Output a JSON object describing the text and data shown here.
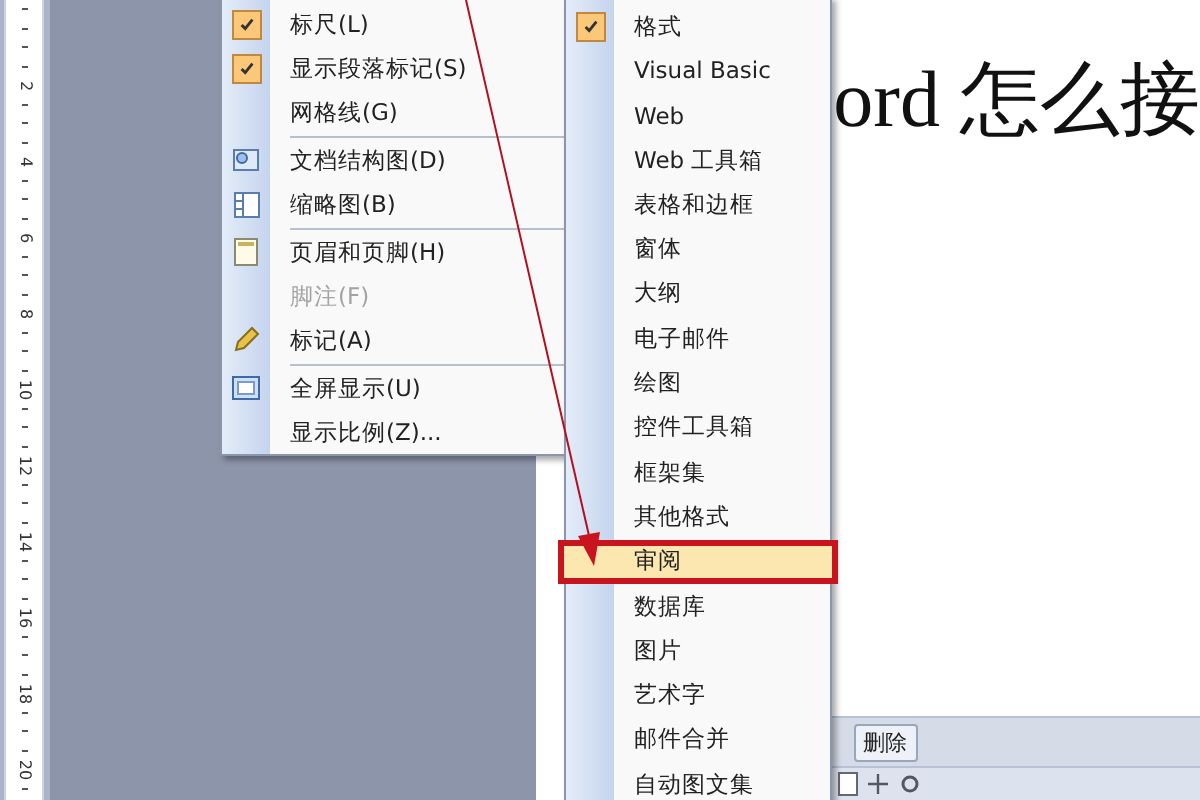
{
  "ruler": {
    "labels": [
      "2",
      "4",
      "6",
      "8",
      "10",
      "12",
      "14",
      "16",
      "18",
      "20"
    ]
  },
  "document": {
    "heading": "ord 怎么接"
  },
  "view_menu": {
    "groups": [
      [
        {
          "label": "标尺(L)",
          "kind": "toggle",
          "checked": true,
          "disabled": false
        },
        {
          "label": "显示段落标记(S)",
          "kind": "toggle",
          "checked": true,
          "disabled": false
        },
        {
          "label": "网格线(G)",
          "kind": "toggle",
          "checked": false,
          "disabled": false
        }
      ],
      [
        {
          "label": "文档结构图(D)",
          "kind": "docmap",
          "disabled": false
        },
        {
          "label": "缩略图(B)",
          "kind": "thumbnails",
          "disabled": false
        }
      ],
      [
        {
          "label": "页眉和页脚(H)",
          "kind": "header",
          "disabled": false
        },
        {
          "label": "脚注(F)",
          "kind": "plain",
          "disabled": true
        },
        {
          "label": "标记(A)",
          "kind": "marker",
          "disabled": false
        }
      ],
      [
        {
          "label": "全屏显示(U)",
          "kind": "fullscreen",
          "disabled": false
        },
        {
          "label": "显示比例(Z)...",
          "kind": "plain",
          "disabled": false
        }
      ]
    ]
  },
  "toolbars_menu": {
    "items": [
      {
        "label": "格式",
        "checked": true,
        "selected": false
      },
      {
        "label": "Visual Basic",
        "checked": false,
        "selected": false
      },
      {
        "label": "Web",
        "checked": false,
        "selected": false
      },
      {
        "label": "Web 工具箱",
        "checked": false,
        "selected": false
      },
      {
        "label": "表格和边框",
        "checked": false,
        "selected": false
      },
      {
        "label": "窗体",
        "checked": false,
        "selected": false
      },
      {
        "label": "大纲",
        "checked": false,
        "selected": false
      },
      {
        "label": "电子邮件",
        "checked": false,
        "selected": false
      },
      {
        "label": "绘图",
        "checked": false,
        "selected": false
      },
      {
        "label": "控件工具箱",
        "checked": false,
        "selected": false
      },
      {
        "label": "框架集",
        "checked": false,
        "selected": false
      },
      {
        "label": "其他格式",
        "checked": false,
        "selected": false
      },
      {
        "label": "审阅",
        "checked": false,
        "selected": true
      },
      {
        "label": "数据库",
        "checked": false,
        "selected": false
      },
      {
        "label": "图片",
        "checked": false,
        "selected": false
      },
      {
        "label": "艺术字",
        "checked": false,
        "selected": false
      },
      {
        "label": "邮件合并",
        "checked": false,
        "selected": false
      },
      {
        "label": "自动图文集",
        "checked": false,
        "selected": false
      }
    ]
  },
  "toolbar": {
    "buttons": [
      "删除"
    ]
  }
}
